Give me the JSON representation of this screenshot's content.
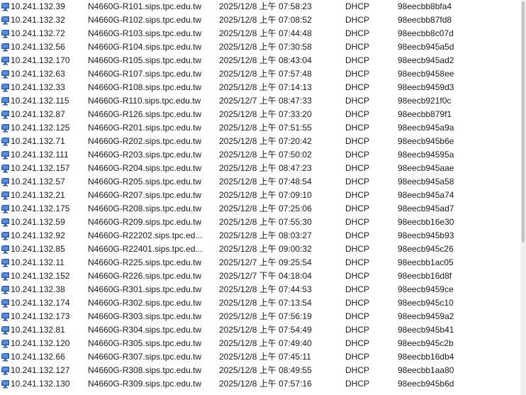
{
  "leases": [
    {
      "ip": "10.241.132.39",
      "name": "N4660G-R101.sips.tpc.edu.tw",
      "expiry": "2025/12/8 上午 07:58:23",
      "type": "DHCP",
      "unique_id": "98eecbb8bfa4"
    },
    {
      "ip": "10.241.132.32",
      "name": "N4660G-R102.sips.tpc.edu.tw",
      "expiry": "2025/12/8 上午 07:08:52",
      "type": "DHCP",
      "unique_id": "98eecbb87fd8"
    },
    {
      "ip": "10.241.132.72",
      "name": "N4660G-R103.sips.tpc.edu.tw",
      "expiry": "2025/12/8 上午 07:44:48",
      "type": "DHCP",
      "unique_id": "98eecbb8c07d"
    },
    {
      "ip": "10.241.132.56",
      "name": "N4660G-R104.sips.tpc.edu.tw",
      "expiry": "2025/12/8 上午 07:30:58",
      "type": "DHCP",
      "unique_id": "98eecb945a5d"
    },
    {
      "ip": "10.241.132.170",
      "name": "N4660G-R105.sips.tpc.edu.tw",
      "expiry": "2025/12/8 上午 08:43:04",
      "type": "DHCP",
      "unique_id": "98eecb945ad2"
    },
    {
      "ip": "10.241.132.63",
      "name": "N4660G-R107.sips.tpc.edu.tw",
      "expiry": "2025/12/8 上午 07:57:48",
      "type": "DHCP",
      "unique_id": "98eecb9458ee"
    },
    {
      "ip": "10.241.132.33",
      "name": "N4660G-R108.sips.tpc.edu.tw",
      "expiry": "2025/12/8 上午 07:14:13",
      "type": "DHCP",
      "unique_id": "98eecb9459d3"
    },
    {
      "ip": "10.241.132.115",
      "name": "N4660G-R110.sips.tpc.edu.tw",
      "expiry": "2025/12/7 上午 08:47:33",
      "type": "DHCP",
      "unique_id": "98eecb921f0c"
    },
    {
      "ip": "10.241.132.87",
      "name": "N4660G-R126.sips.tpc.edu.tw",
      "expiry": "2025/12/8 上午 07:33:20",
      "type": "DHCP",
      "unique_id": "98eecbb879f1"
    },
    {
      "ip": "10.241.132.125",
      "name": "N4660G-R201.sips.tpc.edu.tw",
      "expiry": "2025/12/8 上午 07:51:55",
      "type": "DHCP",
      "unique_id": "98eecb945a9a"
    },
    {
      "ip": "10.241.132.71",
      "name": "N4660G-R202.sips.tpc.edu.tw",
      "expiry": "2025/12/8 上午 07:20:42",
      "type": "DHCP",
      "unique_id": "98eecb945b6e"
    },
    {
      "ip": "10.241.132.111",
      "name": "N4660G-R203.sips.tpc.edu.tw",
      "expiry": "2025/12/8 上午 07:50:02",
      "type": "DHCP",
      "unique_id": "98eecb94595a"
    },
    {
      "ip": "10.241.132.157",
      "name": "N4660G-R204.sips.tpc.edu.tw",
      "expiry": "2025/12/8 上午 08:47:23",
      "type": "DHCP",
      "unique_id": "98eecb945aae"
    },
    {
      "ip": "10.241.132.57",
      "name": "N4660G-R205.sips.tpc.edu.tw",
      "expiry": "2025/12/8 上午 07:48:54",
      "type": "DHCP",
      "unique_id": "98eecb945a58"
    },
    {
      "ip": "10.241.132.21",
      "name": "N4660G-R207.sips.tpc.edu.tw",
      "expiry": "2025/12/8 上午 07:09:10",
      "type": "DHCP",
      "unique_id": "98eecb945a74"
    },
    {
      "ip": "10.241.132.175",
      "name": "N4660G-R208.sips.tpc.edu.tw",
      "expiry": "2025/12/8 上午 07:25:06",
      "type": "DHCP",
      "unique_id": "98eecb945ad7"
    },
    {
      "ip": "10.241.132.59",
      "name": "N4660G-R209.sips.tpc.edu.tw",
      "expiry": "2025/12/8 上午 07:55:30",
      "type": "DHCP",
      "unique_id": "98eecbb16e30"
    },
    {
      "ip": "10.241.132.92",
      "name": "N4660G-R22202.sips.tpc.ed...",
      "expiry": "2025/12/8 上午 08:03:27",
      "type": "DHCP",
      "unique_id": "98eecb945b93"
    },
    {
      "ip": "10.241.132.85",
      "name": "N4660G-R22401.sips.tpc.ed...",
      "expiry": "2025/12/8 上午 09:00:32",
      "type": "DHCP",
      "unique_id": "98eecb945c26"
    },
    {
      "ip": "10.241.132.11",
      "name": "N4660G-R225.sips.tpc.edu.tw",
      "expiry": "2025/12/7 上午 09:25:54",
      "type": "DHCP",
      "unique_id": "98eecbb1ac05"
    },
    {
      "ip": "10.241.132.152",
      "name": "N4660G-R226.sips.tpc.edu.tw",
      "expiry": "2025/12/7 下午 04:18:04",
      "type": "DHCP",
      "unique_id": "98eecbb16d8f"
    },
    {
      "ip": "10.241.132.38",
      "name": "N4660G-R301.sips.tpc.edu.tw",
      "expiry": "2025/12/8 上午 07:44:53",
      "type": "DHCP",
      "unique_id": "98eecb9459ce"
    },
    {
      "ip": "10.241.132.174",
      "name": "N4660G-R302.sips.tpc.edu.tw",
      "expiry": "2025/12/8 上午 07:13:54",
      "type": "DHCP",
      "unique_id": "98eecb945c10"
    },
    {
      "ip": "10.241.132.173",
      "name": "N4660G-R303.sips.tpc.edu.tw",
      "expiry": "2025/12/8 上午 07:56:19",
      "type": "DHCP",
      "unique_id": "98eecb9459a2"
    },
    {
      "ip": "10.241.132.81",
      "name": "N4660G-R304.sips.tpc.edu.tw",
      "expiry": "2025/12/8 上午 07:54:49",
      "type": "DHCP",
      "unique_id": "98eecb945b41"
    },
    {
      "ip": "10.241.132.120",
      "name": "N4660G-R305.sips.tpc.edu.tw",
      "expiry": "2025/12/8 上午 07:49:40",
      "type": "DHCP",
      "unique_id": "98eecb945c2b"
    },
    {
      "ip": "10.241.132.66",
      "name": "N4660G-R307.sips.tpc.edu.tw",
      "expiry": "2025/12/8 上午 07:45:11",
      "type": "DHCP",
      "unique_id": "98eecbb16db4"
    },
    {
      "ip": "10.241.132.127",
      "name": "N4660G-R308.sips.tpc.edu.tw",
      "expiry": "2025/12/8 上午 08:49:55",
      "type": "DHCP",
      "unique_id": "98eecbb1aa80"
    },
    {
      "ip": "10.241.132.130",
      "name": "N4660G-R309.sips.tpc.edu.tw",
      "expiry": "2025/12/8 上午 07:57:16",
      "type": "DHCP",
      "unique_id": "98eecb945b6d"
    }
  ],
  "icons": {
    "row_icon": "computer-lease-icon"
  },
  "colors": {
    "icon_blue": "#2f5fb3",
    "icon_screen": "#5b8fd9",
    "text": "#1a1a1a",
    "background": "#ffffff"
  }
}
